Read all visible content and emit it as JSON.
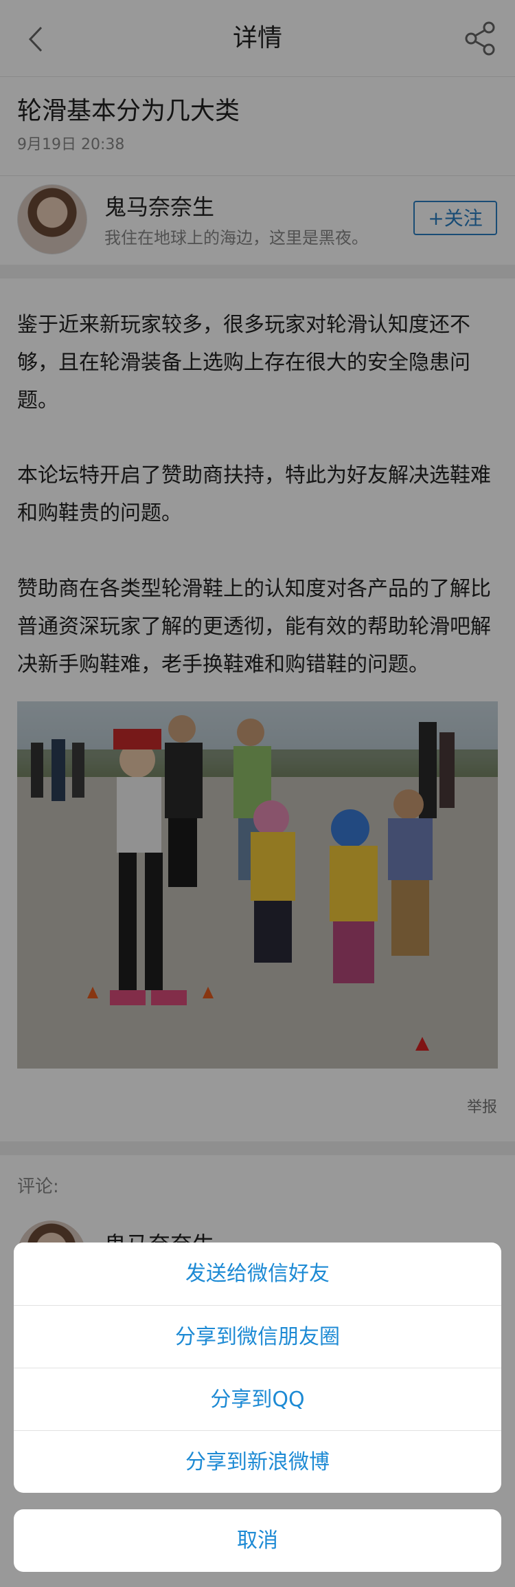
{
  "header": {
    "title": "详情"
  },
  "post": {
    "title": "轮滑基本分为几大类",
    "time": "9月19日 20:38"
  },
  "author": {
    "name": "鬼马奈奈生",
    "bio": "我住在地球上的海边，这里是黑夜。",
    "follow_label": "+关注"
  },
  "content": {
    "paragraphs": [
      "鉴于近来新玩家较多，很多玩家对轮滑认知度还不够，且在轮滑装备上选购上存在很大的安全隐患问题。",
      "本论坛特开启了赞助商扶持，特此为好友解决选鞋难和购鞋贵的问题。",
      "赞助商在各类型轮滑鞋上的认知度对各产品的了解比普通资深玩家了解的更透彻，能有效的帮助轮滑吧解决新手购鞋难，老手换鞋难和购错鞋的问题。"
    ],
    "report_label": "举报"
  },
  "comments": {
    "label": "评论:",
    "first_author": "鬼马奈奈生"
  },
  "share_sheet": {
    "options": [
      "发送给微信好友",
      "分享到微信朋友圈",
      "分享到QQ",
      "分享到新浪微博"
    ],
    "cancel_label": "取消"
  },
  "colors": {
    "accent": "#1d8ad4",
    "follow": "#2b7fc3",
    "overlay": "rgba(0,0,0,0.40)"
  },
  "icons": [
    "back-arrow-icon",
    "share-icon"
  ]
}
